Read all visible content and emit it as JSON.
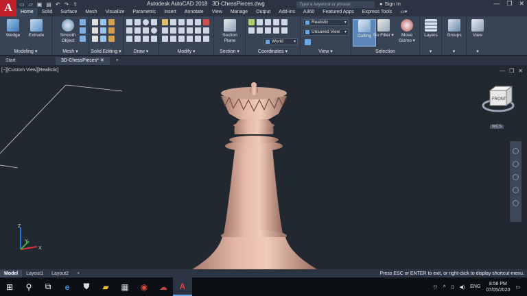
{
  "app": {
    "logo_letter": "A",
    "title": "Autodesk AutoCAD 2018",
    "filename": "3D-ChessPieces.dwg",
    "search_placeholder": "Type a keyword or phrase",
    "sign_in": "Sign In"
  },
  "tabs": [
    "Home",
    "Solid",
    "Surface",
    "Mesh",
    "Visualize",
    "Parametric",
    "Insert",
    "Annotate",
    "View",
    "Manage",
    "Output",
    "Add-ins",
    "A360",
    "Featured Apps",
    "Express Tools"
  ],
  "active_tab": "Home",
  "ribbon": {
    "modeling": {
      "title": "Modeling",
      "wedge": "Wedge",
      "extrude": "Extrude"
    },
    "mesh": {
      "title": "Mesh",
      "smooth_object_1": "Smooth",
      "smooth_object_2": "Object"
    },
    "solid_editing": {
      "title": "Solid Editing"
    },
    "draw": {
      "title": "Draw"
    },
    "modify": {
      "title": "Modify"
    },
    "section": {
      "title": "Section",
      "section_plane_1": "Section",
      "section_plane_2": "Plane"
    },
    "coordinates": {
      "title": "Coordinates",
      "ucs": "World"
    },
    "view": {
      "title": "View",
      "visual_style": "Realistic",
      "named_view": "Unsaved View"
    },
    "selection": {
      "title": "Selection",
      "culling": "Culling",
      "no_filter": "No Filter",
      "move_gizmo_1": "Move",
      "move_gizmo_2": "Gizmo"
    },
    "layers": "Layers",
    "groups": "Groups",
    "view_btn": "View"
  },
  "doc_tabs": [
    "Start",
    "3D-ChessPieces*"
  ],
  "viewport": {
    "label": "[−][Custom View][Realistic]",
    "viewcube_face": "FRONT",
    "wcs": "WCS",
    "axis_x": "X",
    "axis_y": "Y",
    "axis_z": "Z"
  },
  "layout_tabs": [
    "Model",
    "Layout1",
    "Layout2"
  ],
  "status_message": "Press ESC or ENTER to exit, or right-click to display shortcut-menu.",
  "tray": {
    "lang": "ENG",
    "time": "8:56 PM",
    "date": "07/05/2020"
  },
  "colors": {
    "accent_red": "#c0202a",
    "ribbon_bg": "#384456",
    "viewport_bg": "#212830",
    "piece": "#d9a99a"
  }
}
